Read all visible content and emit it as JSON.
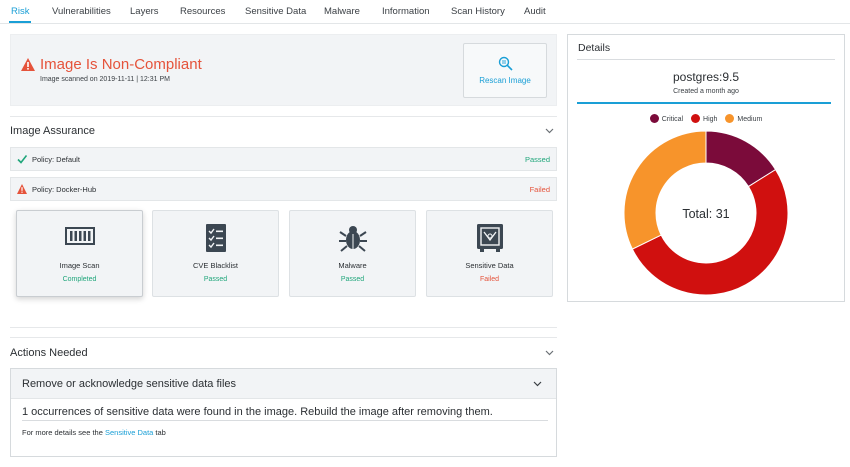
{
  "tabs": [
    {
      "label": "Risk",
      "active": true
    },
    {
      "label": "Vulnerabilities",
      "active": false
    },
    {
      "label": "Layers",
      "active": false
    },
    {
      "label": "Resources",
      "active": false
    },
    {
      "label": "Sensitive Data",
      "active": false
    },
    {
      "label": "Malware",
      "active": false
    },
    {
      "label": "Information",
      "active": false
    },
    {
      "label": "Scan History",
      "active": false
    },
    {
      "label": "Audit",
      "active": false
    }
  ],
  "banner": {
    "title": "Image Is Non-Compliant",
    "subtitle": "Image scanned on 2019-11-11 | 12:31 PM",
    "rescan_label": "Rescan Image",
    "icon": "warning-icon"
  },
  "assurance": {
    "heading": "Image Assurance",
    "policies": [
      {
        "name": "Policy: Default",
        "status": "Passed",
        "icon": "check-icon"
      },
      {
        "name": "Policy: Docker-Hub",
        "status": "Failed",
        "icon": "warning-icon"
      }
    ],
    "cards": [
      {
        "title": "Image Scan",
        "status": "Completed",
        "icon": "barcode-icon"
      },
      {
        "title": "CVE Blacklist",
        "status": "Passed",
        "icon": "checklist-icon"
      },
      {
        "title": "Malware",
        "status": "Passed",
        "icon": "bug-icon"
      },
      {
        "title": "Sensitive Data",
        "status": "Failed",
        "icon": "safe-icon"
      }
    ]
  },
  "actions": {
    "heading": "Actions Needed",
    "item_title": "Remove or acknowledge sensitive data files",
    "message": "1 occurrences of sensitive data were found in the image. Rebuild the image after removing them.",
    "more_prefix": "For more details see the",
    "more_link": "Sensitive Data",
    "more_suffix": "tab"
  },
  "details": {
    "heading": "Details",
    "image_name": "postgres:9.5",
    "created": "Created a month ago"
  },
  "colors": {
    "accent": "#1a9fd6",
    "passed": "#20a67b",
    "failed": "#e5533b",
    "critical": "#7b0b3a",
    "high": "#d0100f",
    "medium": "#f7942b"
  },
  "chart_data": {
    "type": "pie",
    "variant": "donut",
    "categories": [
      "Critical",
      "High",
      "Medium"
    ],
    "values": [
      5,
      16,
      10
    ],
    "colors": [
      "#7b0b3a",
      "#d0100f",
      "#f7942b"
    ],
    "center_label": "Total: 31",
    "legend_position": "top"
  }
}
